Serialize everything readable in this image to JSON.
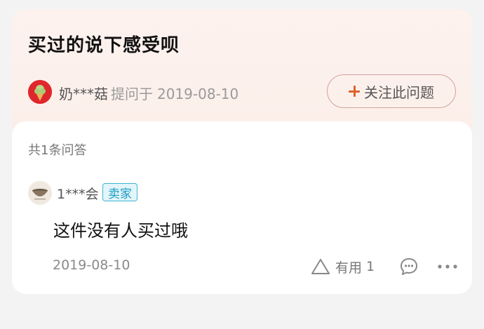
{
  "question": {
    "title": "买过的说下感受呗",
    "asker_name": "奶***菇",
    "asked_label": "提问于",
    "asked_date": "2019-08-10",
    "follow_label": "关注此问题"
  },
  "answers": {
    "count_label": "共1条问答",
    "items": [
      {
        "author": "1***会",
        "badge": "卖家",
        "text": "这件没有人买过哦",
        "date": "2019-08-10",
        "useful_label": "有用",
        "useful_count": "1"
      }
    ]
  },
  "icons": {
    "asker_avatar": "ice-cream-avatar-icon",
    "answerer_avatar": "bowl-avatar-icon",
    "follow": "plus-icon",
    "useful": "triangle-thumb-icon",
    "comment": "comment-bubble-icon",
    "more": "more-dots-icon"
  },
  "colors": {
    "question_bg": "#fdf2ee",
    "accent": "#e0612b",
    "badge_border": "#3fb5d4",
    "badge_text": "#1a9cc2"
  }
}
